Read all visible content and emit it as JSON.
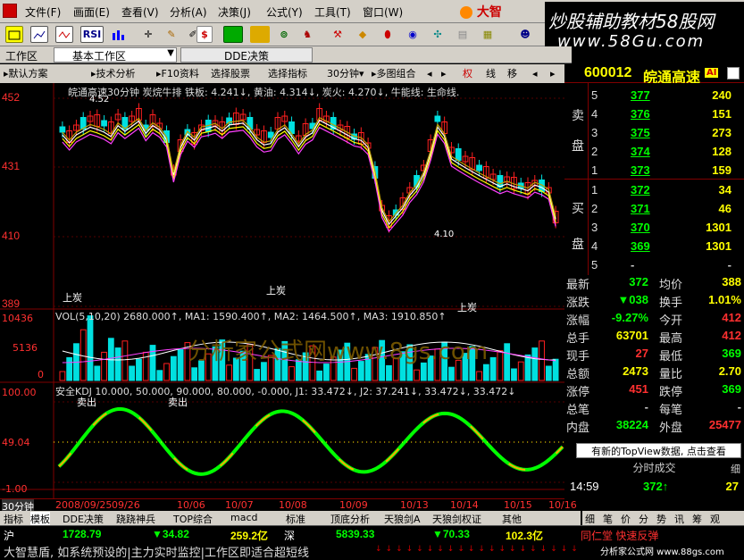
{
  "menu": {
    "items": [
      "文件(F)",
      "画面(E)",
      "查看(V)",
      "分析(A)",
      "决策(J)",
      "公式(Y)",
      "工具(T)",
      "窗口(W)"
    ],
    "brand": "大智"
  },
  "overlay_banner": {
    "text": "炒股辅助教材58股网",
    "url": "www.58Gu.com"
  },
  "toolbar": {
    "rsi_label": "RSI",
    "dollar_label": "$"
  },
  "workspace": {
    "label": "工作区",
    "selector_value": "基本工作区",
    "dde_label": "DDE决策"
  },
  "tabs": [
    "默认方案",
    "技术分析",
    "F10资料",
    "选择股票",
    "选择指标",
    "30分钟",
    "多图组合",
    "权",
    "线",
    "移"
  ],
  "stock": {
    "code": "600012",
    "name": "皖通高速",
    "badge": "AI"
  },
  "chart": {
    "title_line": "皖通高速30分钟 炭烷牛排 铁板: 4.241↓, 黄油: 4.314↓, 炭火: 4.270↓, 牛能线: 生命线.",
    "price_axis": [
      "452",
      "431",
      "410",
      "389"
    ],
    "high_label": "4.52",
    "low_label": "4.10",
    "annot_left": "上炭",
    "annot_mid": "上炭",
    "annot_right": "上炭",
    "vol_line": "VOL(5,10,20) 2680.000↑, MA1: 1590.400↑, MA2: 1464.500↑, MA3: 1910.850↑",
    "vol_axis": [
      "10436",
      "5136",
      "0"
    ],
    "kdj_line": "安全KDJ 10.000, 50.000, 90.000, 80.000, -0.000, J1: 33.472↓, J2: 37.241↓, 33.472↓, 33.472↓",
    "kdj_axis": [
      "100.00",
      "49.04",
      "-1.00"
    ],
    "sell_labels": [
      "卖出",
      "卖出"
    ],
    "watermark": "分析家公式网www.8gs.com",
    "date_axis": [
      "2008/09/25",
      "09/26",
      "10/06",
      "10/07",
      "10/08",
      "10/09",
      "10/13",
      "10/14",
      "10/15",
      "10/16"
    ],
    "period": "30分钟"
  },
  "chart_data": {
    "type": "bar",
    "title": "皖通高速30分钟",
    "ylim": [
      3.89,
      4.52
    ]
  },
  "orderbook": {
    "sell_label": [
      "卖",
      "盘"
    ],
    "buy_label": [
      "买",
      "盘"
    ],
    "asks": [
      {
        "lvl": "5",
        "price": "377",
        "vol": "240"
      },
      {
        "lvl": "4",
        "price": "376",
        "vol": "151"
      },
      {
        "lvl": "3",
        "price": "375",
        "vol": "273"
      },
      {
        "lvl": "2",
        "price": "374",
        "vol": "128"
      },
      {
        "lvl": "1",
        "price": "373",
        "vol": "159"
      }
    ],
    "bids": [
      {
        "lvl": "1",
        "price": "372",
        "vol": "34"
      },
      {
        "lvl": "2",
        "price": "371",
        "vol": "46"
      },
      {
        "lvl": "3",
        "price": "370",
        "vol": "1301"
      },
      {
        "lvl": "4",
        "price": "369",
        "vol": "1301"
      },
      {
        "lvl": "5",
        "price": "-",
        "vol": "-"
      }
    ]
  },
  "quote": [
    {
      "l1": "最新",
      "v1": "372",
      "c1": "#00ff00",
      "l2": "均价",
      "v2": "388",
      "c2": "#ffff00"
    },
    {
      "l1": "涨跌",
      "v1": "▼038",
      "c1": "#00ff00",
      "l2": "换手",
      "v2": "1.01%",
      "c2": "#ffff00"
    },
    {
      "l1": "涨幅",
      "v1": "-9.27%",
      "c1": "#00ff00",
      "l2": "今开",
      "v2": "412",
      "c2": "#ff3030"
    },
    {
      "l1": "总手",
      "v1": "63701",
      "c1": "#ffff00",
      "l2": "最高",
      "v2": "412",
      "c2": "#ff3030"
    },
    {
      "l1": "现手",
      "v1": "27",
      "c1": "#ff3030",
      "l2": "最低",
      "v2": "369",
      "c2": "#00ff00"
    },
    {
      "l1": "总额",
      "v1": "2473",
      "c1": "#ffff00",
      "l2": "量比",
      "v2": "2.70",
      "c2": "#ffff00"
    },
    {
      "l1": "涨停",
      "v1": "451",
      "c1": "#ff3030",
      "l2": "跌停",
      "v2": "369",
      "c2": "#00ff00"
    },
    {
      "l1": "总笔",
      "v1": "-",
      "c1": "#ccc",
      "l2": "每笔",
      "v2": "-",
      "c2": "#ccc"
    },
    {
      "l1": "内盘",
      "v1": "38224",
      "c1": "#00ff00",
      "l2": "外盘",
      "v2": "25477",
      "c2": "#ff3030"
    }
  ],
  "topview": "有新的TopView数据, 点击查看",
  "trades": {
    "title": "分时成交",
    "side_label": "细",
    "time": "14:59",
    "price": "372↑",
    "vol": "27"
  },
  "bottom_tabs": [
    "指标",
    "模板",
    "DDE决策",
    "跷跷神兵",
    "TOP综合",
    "macd",
    "标准",
    "顶底分析",
    "天狼剑A",
    "天狼剑权证",
    "其他"
  ],
  "right_tabs": [
    "细",
    "笔",
    "价",
    "分",
    "势",
    "讯",
    "筹",
    "观"
  ],
  "status": {
    "sh_label": "沪",
    "sh_index": "1728.79",
    "sh_change": "▼34.82",
    "sh_amount": "259.2亿",
    "sz_label": "深",
    "sz_index": "5839.33",
    "sz_change": "▼70.33",
    "sz_amount": "102.3亿",
    "extra": "同仁堂 快速反弹"
  },
  "ticker": {
    "text": "大智慧盾, 如系统预设的|主力实时监控|工作区即适合超短线",
    "site": "分析家公式网 www.88gs.com"
  }
}
